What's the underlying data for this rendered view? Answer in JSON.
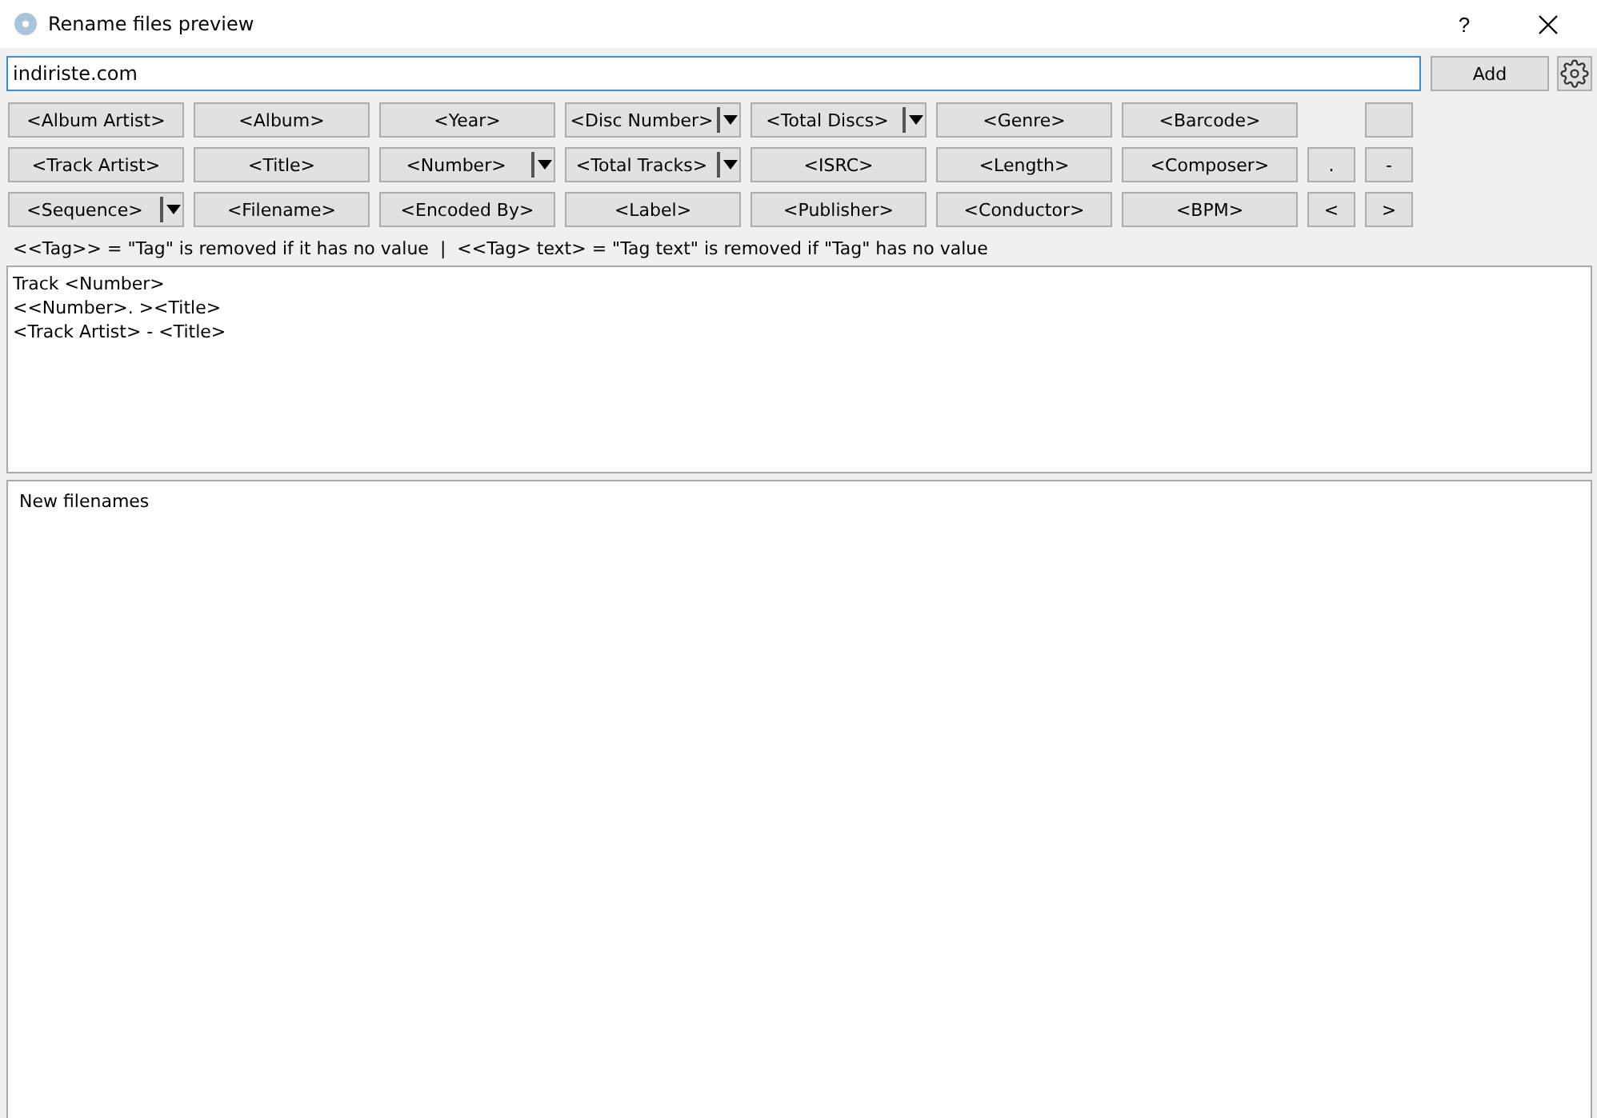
{
  "window": {
    "title": "Rename files preview",
    "help": "?"
  },
  "pattern_field": {
    "value": "indiriste.com"
  },
  "add_button": "Add",
  "tag_rows": [
    [
      {
        "kind": "plain",
        "label": "<Album Artist>"
      },
      {
        "kind": "plain",
        "label": "<Album>"
      },
      {
        "kind": "plain",
        "label": "<Year>"
      },
      {
        "kind": "split",
        "label": "<Disc Number>"
      },
      {
        "kind": "split",
        "label": "<Total Discs>"
      },
      {
        "kind": "plain",
        "label": "<Genre>"
      },
      {
        "kind": "plain",
        "label": "<Barcode>"
      },
      {
        "kind": "gap"
      },
      {
        "kind": "blank"
      }
    ],
    [
      {
        "kind": "plain",
        "label": "<Track Artist>"
      },
      {
        "kind": "plain",
        "label": "<Title>"
      },
      {
        "kind": "split",
        "label": "<Number>"
      },
      {
        "kind": "split",
        "label": "<Total Tracks>"
      },
      {
        "kind": "plain",
        "label": "<ISRC>"
      },
      {
        "kind": "plain",
        "label": "<Length>"
      },
      {
        "kind": "plain",
        "label": "<Composer>"
      },
      {
        "kind": "plain",
        "label": "."
      },
      {
        "kind": "plain",
        "label": "-"
      }
    ],
    [
      {
        "kind": "split",
        "label": "<Sequence>"
      },
      {
        "kind": "plain",
        "label": "<Filename>"
      },
      {
        "kind": "plain",
        "label": "<Encoded By>"
      },
      {
        "kind": "plain",
        "label": "<Label>"
      },
      {
        "kind": "plain",
        "label": "<Publisher>"
      },
      {
        "kind": "plain",
        "label": "<Conductor>"
      },
      {
        "kind": "plain",
        "label": "<BPM>"
      },
      {
        "kind": "plain",
        "label": "<"
      },
      {
        "kind": "plain",
        "label": ">"
      }
    ]
  ],
  "hint": "<<Tag>> = \"Tag\" is removed if it has no value  |  <<Tag> text> = \"Tag text\" is removed if \"Tag\" has no value",
  "templates": [
    "Track <Number>",
    "<<Number>. ><Title>",
    "<Track Artist> - <Title>"
  ],
  "preview": {
    "header": "New filenames"
  }
}
